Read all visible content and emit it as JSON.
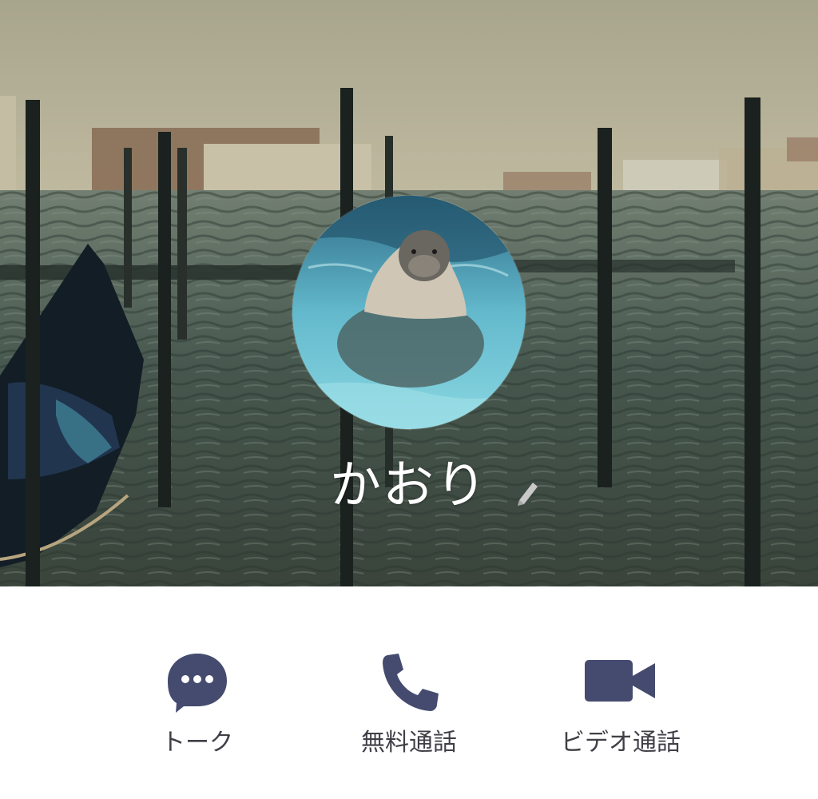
{
  "profile": {
    "name": "かおり",
    "cover_photo_icon": "cover-photo",
    "avatar_icon": "avatar-photo"
  },
  "actions": [
    {
      "id": "talk",
      "label": "トーク",
      "icon": "chat-bubble-icon"
    },
    {
      "id": "voice",
      "label": "無料通話",
      "icon": "phone-icon"
    },
    {
      "id": "video",
      "label": "ビデオ通話",
      "icon": "video-camera-icon"
    }
  ],
  "colors": {
    "icon": "#454b6e",
    "label": "#3f3f46",
    "name": "#ffffff",
    "background": "#ffffff"
  }
}
